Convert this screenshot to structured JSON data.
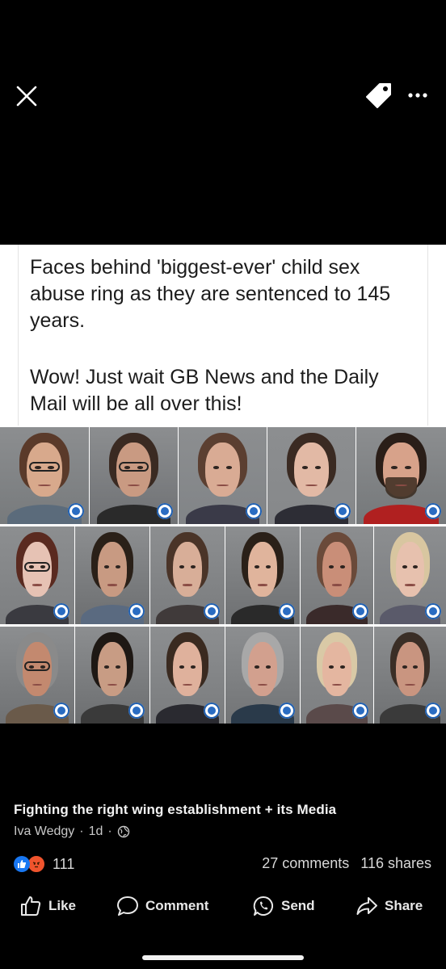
{
  "toolbar": {
    "close_icon": "close-icon",
    "tag_icon": "tag-icon",
    "more_icon": "more-horizontal-icon"
  },
  "image_caption": {
    "line1": "Faces behind 'biggest-ever' child sex abuse ring as they are sentenced to 145 years.",
    "line2": "Wow! Just wait GB News and the Daily Mail will be all over this!"
  },
  "post": {
    "title": "Fighting the right wing establishment + its Media",
    "author": "Iva Wedgy",
    "dot": "·",
    "time": "1d",
    "privacy_icon": "globe-icon"
  },
  "engagement": {
    "reaction_count": "111",
    "comments": "27 comments",
    "shares": "116 shares",
    "colors": {
      "like": "#1877f2",
      "angry": "#f0542d"
    }
  },
  "actions": {
    "like": "Like",
    "comment": "Comment",
    "send": "Send",
    "share": "Share"
  }
}
